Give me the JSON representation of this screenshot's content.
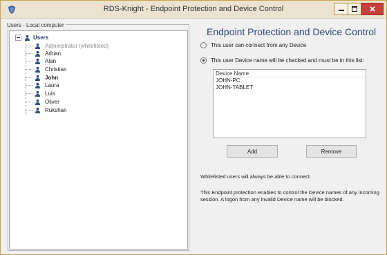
{
  "window": {
    "title": "RDS-Knight - Endpoint Protection and Device Control",
    "accent_color": "#c9a34b",
    "close_color": "#c7403a",
    "icons": {
      "app": "rds-knight-shield-icon",
      "minimize": "minimize-icon",
      "maximize": "maximize-icon",
      "close": "close-icon"
    }
  },
  "left_panel": {
    "group_label": "Users - Local computer",
    "tree": {
      "root_label": "Users",
      "root_icon": "users-icon",
      "items": [
        {
          "label": "Administrator (whitelisted)",
          "style": "muted",
          "icon": "user-icon"
        },
        {
          "label": "Adrian",
          "style": "normal",
          "icon": "user-icon"
        },
        {
          "label": "Alan",
          "style": "normal",
          "icon": "user-icon"
        },
        {
          "label": "Christian",
          "style": "normal",
          "icon": "user-icon"
        },
        {
          "label": "John",
          "style": "bold",
          "icon": "user-icon"
        },
        {
          "label": "Laura",
          "style": "normal",
          "icon": "user-icon"
        },
        {
          "label": "Luis",
          "style": "normal",
          "icon": "user-icon"
        },
        {
          "label": "Oliver",
          "style": "normal",
          "icon": "user-icon"
        },
        {
          "label": "Rukshan",
          "style": "normal",
          "icon": "user-icon"
        }
      ]
    }
  },
  "right_panel": {
    "title": "Endpoint Protection and Device Control",
    "options": [
      {
        "label": "This user can connect from any Device",
        "checked": false
      },
      {
        "label": "This user Device name will be checked and must be in this list:",
        "checked": true
      }
    ],
    "device_list": {
      "header": "Device Name",
      "rows": [
        "JOHN-PC",
        "JOHN-TABLET"
      ]
    },
    "buttons": {
      "add": "Add",
      "remove": "Remove"
    },
    "note_whitelist": "Whitelisted users will always be able to connect.",
    "note_description": "This Endpoint protection enables to control the Device names of any incoming session. A logon from any invalid Device name will be blocked."
  }
}
